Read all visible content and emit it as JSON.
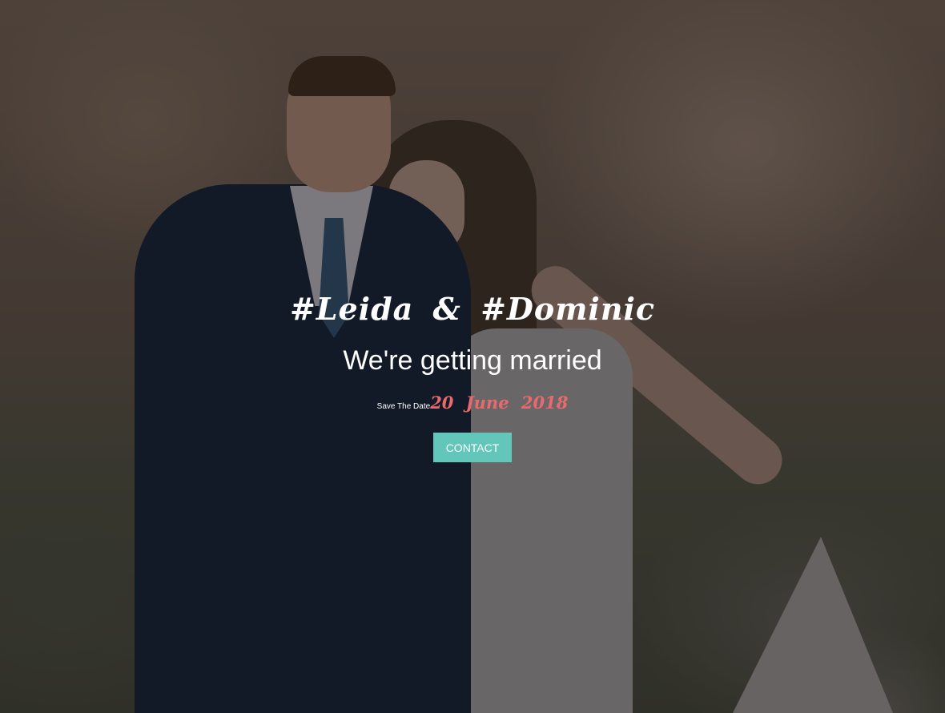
{
  "hero": {
    "names": "#Leida & #Dominic",
    "tagline": "We're getting married",
    "save_label": "Save The Date",
    "date": "20 June 2018",
    "contact_label": "CONTACT"
  },
  "colors": {
    "accent": "#63c6bb",
    "date": "#e86a6e"
  }
}
